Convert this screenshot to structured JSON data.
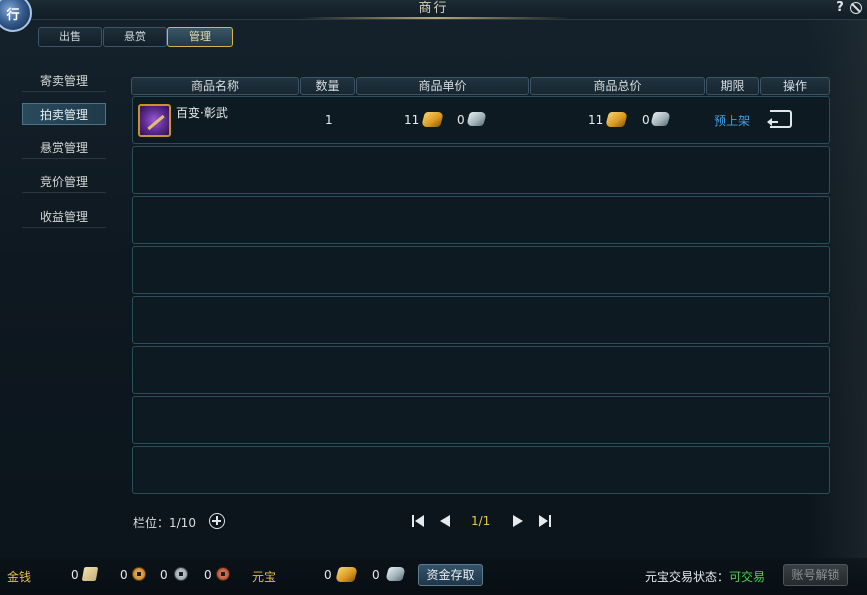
{
  "window": {
    "title": "商行"
  },
  "logo": {
    "text": "行"
  },
  "top_tabs": [
    {
      "label": "出售",
      "active": false
    },
    {
      "label": "悬赏",
      "active": false
    },
    {
      "label": "管理",
      "active": true
    }
  ],
  "sidebar": {
    "items": [
      {
        "label": "寄卖管理",
        "active": false
      },
      {
        "label": "拍卖管理",
        "active": true
      },
      {
        "label": "悬赏管理",
        "active": false
      },
      {
        "label": "竞价管理",
        "active": false
      },
      {
        "label": "收益管理",
        "active": false
      }
    ]
  },
  "table": {
    "columns": [
      "商品名称",
      "数量",
      "商品单价",
      "商品总价",
      "期限",
      "操作"
    ],
    "rows": [
      {
        "name": "百变·彰武",
        "quantity": "1",
        "unit_price_gold": "11",
        "unit_price_silver": "0",
        "total_price_gold": "11",
        "total_price_silver": "0",
        "term": "预上架",
        "action_icon": "return-icon"
      }
    ],
    "empty_row_count": 7
  },
  "footer": {
    "slots_label": "栏位：1/10",
    "page_indicator": "1/1"
  },
  "bottom_bar": {
    "money_label": "金钱",
    "scroll_amount": "0",
    "gold_coin_amount": "0",
    "silver_coin_amount": "0",
    "copper_coin_amount": "0",
    "yuanbao_label": "元宝",
    "yuanbao_gold_amount": "0",
    "yuanbao_silver_amount": "0",
    "deposit_button": "资金存取",
    "trade_status_label": "元宝交易状态：",
    "trade_status_value": "可交易",
    "unlock_button": "账号解锁"
  },
  "colors": {
    "accent_gold": "#e3c04a",
    "link_blue": "#3ea0e6",
    "status_green": "#4fd14f"
  }
}
